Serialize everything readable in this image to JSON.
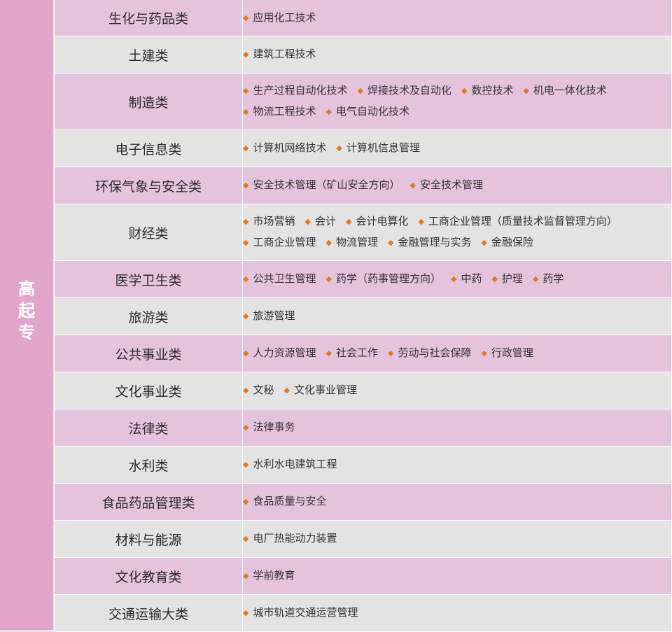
{
  "sidebar": {
    "chars": [
      "高",
      "起",
      "专"
    ]
  },
  "colors": {
    "sidebar": "#e3a6cb",
    "row_pink": "#e5c3dc",
    "row_gray": "#e4e3e4",
    "bullet": "#e8771b"
  },
  "rows": [
    {
      "category": "生化与药品类",
      "majors": [
        "应用化工技术"
      ]
    },
    {
      "category": "土建类",
      "majors": [
        "建筑工程技术"
      ]
    },
    {
      "category": "制造类",
      "majors": [
        "生产过程自动化技术",
        "焊接技术及自动化",
        "数控技术",
        "机电一体化技术",
        "物流工程技术",
        "电气自动化技术"
      ]
    },
    {
      "category": "电子信息类",
      "majors": [
        "计算机网络技术",
        "计算机信息管理"
      ]
    },
    {
      "category": "环保气象与安全类",
      "majors": [
        "安全技术管理（矿山安全方向）",
        "安全技术管理"
      ]
    },
    {
      "category": "财经类",
      "majors": [
        "市场营销",
        "会计",
        "会计电算化",
        "工商企业管理（质量技术监督管理方向）",
        "工商企业管理",
        "物流管理",
        "金融管理与实务",
        "金融保险"
      ]
    },
    {
      "category": "医学卫生类",
      "majors": [
        "公共卫生管理",
        "药学（药事管理方向）",
        "中药",
        "护理",
        "药学"
      ]
    },
    {
      "category": "旅游类",
      "majors": [
        "旅游管理"
      ]
    },
    {
      "category": "公共事业类",
      "majors": [
        "人力资源管理",
        "社会工作",
        "劳动与社会保障",
        "行政管理"
      ]
    },
    {
      "category": "文化事业类",
      "majors": [
        "文秘",
        "文化事业管理"
      ]
    },
    {
      "category": "法律类",
      "majors": [
        "法律事务"
      ]
    },
    {
      "category": "水利类",
      "majors": [
        "水利水电建筑工程"
      ]
    },
    {
      "category": "食品药品管理类",
      "majors": [
        "食品质量与安全"
      ]
    },
    {
      "category": "材料与能源",
      "majors": [
        "电厂热能动力装置"
      ]
    },
    {
      "category": "文化教育类",
      "majors": [
        "学前教育"
      ]
    },
    {
      "category": "交通运输大类",
      "majors": [
        "城市轨道交通运营管理"
      ]
    }
  ]
}
